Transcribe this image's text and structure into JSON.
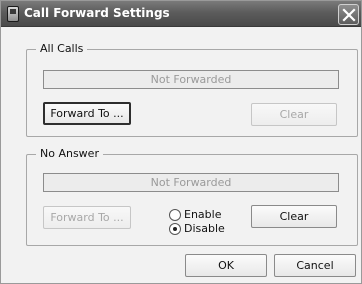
{
  "window": {
    "title": "Call Forward Settings",
    "icon": "phone-app-icon",
    "close_icon": "close-icon"
  },
  "all_calls": {
    "legend": "All Calls",
    "status": "Not Forwarded",
    "forward_label": "Forward To ...",
    "clear_label": "Clear"
  },
  "no_answer": {
    "legend": "No Answer",
    "status": "Not Forwarded",
    "forward_label": "Forward To ...",
    "clear_label": "Clear",
    "enable_label": "Enable",
    "disable_label": "Disable",
    "selected": "Disable"
  },
  "footer": {
    "ok_label": "OK",
    "cancel_label": "Cancel"
  }
}
